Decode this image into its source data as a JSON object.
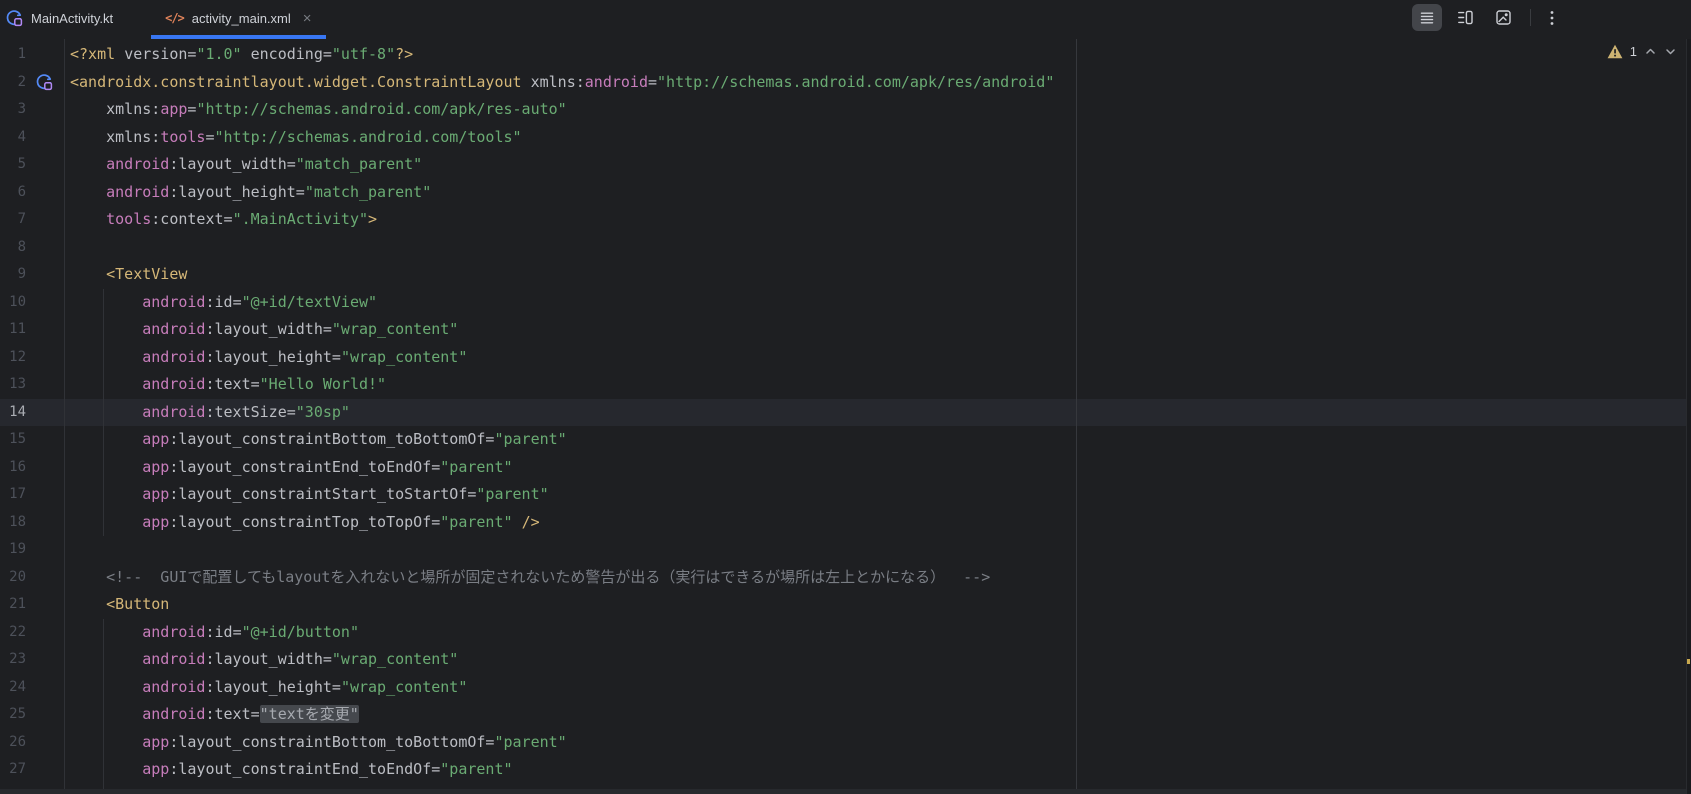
{
  "colors": {
    "editor_bg": "#1E1F22",
    "current_line_bg": "#26282E",
    "active_tab_underline": "#3876F2",
    "syntax_tag": "#D5B778",
    "syntax_namespace": "#C77DBB",
    "syntax_attr": "#BCBEC4",
    "syntax_value": "#6AAB73",
    "syntax_comment": "#7A7E85",
    "warn_highlight_bg": "#45484D",
    "warn_highlight_text": "#A7AAB0",
    "warning_icon": "#CDB372",
    "xml_tab_icon_color": "#E0835A",
    "related_icon_blue": "#548AF7",
    "related_icon_purple": "#B189F5"
  },
  "tabbar": {
    "tabs": [
      {
        "label": "MainActivity.kt",
        "icon": "related-activity-icon",
        "active": false
      },
      {
        "label": "activity_main.xml",
        "icon": "xml-code-icon",
        "icon_glyph": "</>",
        "close_glyph": "×",
        "active": true
      }
    ],
    "view_modes": [
      {
        "name": "code",
        "selected": true
      },
      {
        "name": "split",
        "selected": false
      },
      {
        "name": "design",
        "selected": false
      }
    ]
  },
  "inspection": {
    "warning_count": "1"
  },
  "editor": {
    "current_line": 14,
    "gutter_icon_line": 2,
    "lines": [
      {
        "n": 1,
        "t": [
          [
            "t",
            "<?xml"
          ],
          [
            "p",
            " "
          ],
          [
            "a",
            "version"
          ],
          [
            "p",
            "="
          ],
          [
            "v",
            "\"1.0\""
          ],
          [
            "p",
            " "
          ],
          [
            "a",
            "encoding"
          ],
          [
            "p",
            "="
          ],
          [
            "v",
            "\"utf-8\""
          ],
          [
            "t",
            "?>"
          ]
        ]
      },
      {
        "n": 2,
        "t": [
          [
            "t",
            "<androidx.constraintlayout.widget.ConstraintLayout"
          ],
          [
            "p",
            " "
          ],
          [
            "a",
            "xmlns:"
          ],
          [
            "n",
            "android"
          ],
          [
            "p",
            "="
          ],
          [
            "v",
            "\"http://schemas.android.com/apk/res/android\""
          ]
        ]
      },
      {
        "n": 3,
        "t": [
          [
            "p",
            "    "
          ],
          [
            "a",
            "xmlns:"
          ],
          [
            "n",
            "app"
          ],
          [
            "p",
            "="
          ],
          [
            "v",
            "\"http://schemas.android.com/apk/res-auto\""
          ]
        ]
      },
      {
        "n": 4,
        "t": [
          [
            "p",
            "    "
          ],
          [
            "a",
            "xmlns:"
          ],
          [
            "n",
            "tools"
          ],
          [
            "p",
            "="
          ],
          [
            "v",
            "\"http://schemas.android.com/tools\""
          ]
        ]
      },
      {
        "n": 5,
        "t": [
          [
            "p",
            "    "
          ],
          [
            "n",
            "android"
          ],
          [
            "a",
            ":layout_width"
          ],
          [
            "p",
            "="
          ],
          [
            "v",
            "\"match_parent\""
          ]
        ]
      },
      {
        "n": 6,
        "t": [
          [
            "p",
            "    "
          ],
          [
            "n",
            "android"
          ],
          [
            "a",
            ":layout_height"
          ],
          [
            "p",
            "="
          ],
          [
            "v",
            "\"match_parent\""
          ]
        ]
      },
      {
        "n": 7,
        "t": [
          [
            "p",
            "    "
          ],
          [
            "n",
            "tools"
          ],
          [
            "a",
            ":context"
          ],
          [
            "p",
            "="
          ],
          [
            "v",
            "\".MainActivity\""
          ],
          [
            "t",
            ">"
          ]
        ]
      },
      {
        "n": 8,
        "t": []
      },
      {
        "n": 9,
        "t": [
          [
            "p",
            "    "
          ],
          [
            "t",
            "<TextView"
          ]
        ]
      },
      {
        "n": 10,
        "t": [
          [
            "p",
            "        "
          ],
          [
            "n",
            "android"
          ],
          [
            "a",
            ":id"
          ],
          [
            "p",
            "="
          ],
          [
            "v",
            "\"@+id/textView\""
          ]
        ]
      },
      {
        "n": 11,
        "t": [
          [
            "p",
            "        "
          ],
          [
            "n",
            "android"
          ],
          [
            "a",
            ":layout_width"
          ],
          [
            "p",
            "="
          ],
          [
            "v",
            "\"wrap_content\""
          ]
        ]
      },
      {
        "n": 12,
        "t": [
          [
            "p",
            "        "
          ],
          [
            "n",
            "android"
          ],
          [
            "a",
            ":layout_height"
          ],
          [
            "p",
            "="
          ],
          [
            "v",
            "\"wrap_content\""
          ]
        ]
      },
      {
        "n": 13,
        "t": [
          [
            "p",
            "        "
          ],
          [
            "n",
            "android"
          ],
          [
            "a",
            ":text"
          ],
          [
            "p",
            "="
          ],
          [
            "v",
            "\"Hello World!\""
          ]
        ]
      },
      {
        "n": 14,
        "t": [
          [
            "p",
            "        "
          ],
          [
            "n",
            "android"
          ],
          [
            "a",
            ":textSize"
          ],
          [
            "p",
            "="
          ],
          [
            "v",
            "\"30sp\""
          ]
        ]
      },
      {
        "n": 15,
        "t": [
          [
            "p",
            "        "
          ],
          [
            "n",
            "app"
          ],
          [
            "a",
            ":layout_constraintBottom_toBottomOf"
          ],
          [
            "p",
            "="
          ],
          [
            "v",
            "\"parent\""
          ]
        ]
      },
      {
        "n": 16,
        "t": [
          [
            "p",
            "        "
          ],
          [
            "n",
            "app"
          ],
          [
            "a",
            ":layout_constraintEnd_toEndOf"
          ],
          [
            "p",
            "="
          ],
          [
            "v",
            "\"parent\""
          ]
        ]
      },
      {
        "n": 17,
        "t": [
          [
            "p",
            "        "
          ],
          [
            "n",
            "app"
          ],
          [
            "a",
            ":layout_constraintStart_toStartOf"
          ],
          [
            "p",
            "="
          ],
          [
            "v",
            "\"parent\""
          ]
        ]
      },
      {
        "n": 18,
        "t": [
          [
            "p",
            "        "
          ],
          [
            "n",
            "app"
          ],
          [
            "a",
            ":layout_constraintTop_toTopOf"
          ],
          [
            "p",
            "="
          ],
          [
            "v",
            "\"parent\""
          ],
          [
            "p",
            " "
          ],
          [
            "t",
            "/>"
          ]
        ]
      },
      {
        "n": 19,
        "t": []
      },
      {
        "n": 20,
        "t": [
          [
            "p",
            "    "
          ],
          [
            "c",
            "<!--  GUIで配置してもlayoutを入れないと場所が固定されないため警告が出る（実行はできるが場所は左上とかになる）  -->"
          ]
        ]
      },
      {
        "n": 21,
        "t": [
          [
            "p",
            "    "
          ],
          [
            "t",
            "<Button"
          ]
        ]
      },
      {
        "n": 22,
        "t": [
          [
            "p",
            "        "
          ],
          [
            "n",
            "android"
          ],
          [
            "a",
            ":id"
          ],
          [
            "p",
            "="
          ],
          [
            "v",
            "\"@+id/button\""
          ]
        ]
      },
      {
        "n": 23,
        "t": [
          [
            "p",
            "        "
          ],
          [
            "n",
            "android"
          ],
          [
            "a",
            ":layout_width"
          ],
          [
            "p",
            "="
          ],
          [
            "v",
            "\"wrap_content\""
          ]
        ]
      },
      {
        "n": 24,
        "t": [
          [
            "p",
            "        "
          ],
          [
            "n",
            "android"
          ],
          [
            "a",
            ":layout_height"
          ],
          [
            "p",
            "="
          ],
          [
            "v",
            "\"wrap_content\""
          ]
        ]
      },
      {
        "n": 25,
        "t": [
          [
            "p",
            "        "
          ],
          [
            "n",
            "android"
          ],
          [
            "a",
            ":text"
          ],
          [
            "p",
            "="
          ],
          [
            "w",
            "\"textを変更\""
          ]
        ]
      },
      {
        "n": 26,
        "t": [
          [
            "p",
            "        "
          ],
          [
            "n",
            "app"
          ],
          [
            "a",
            ":layout_constraintBottom_toBottomOf"
          ],
          [
            "p",
            "="
          ],
          [
            "v",
            "\"parent\""
          ]
        ]
      },
      {
        "n": 27,
        "t": [
          [
            "p",
            "        "
          ],
          [
            "n",
            "app"
          ],
          [
            "a",
            ":layout_constraintEnd_toEndOf"
          ],
          [
            "p",
            "="
          ],
          [
            "v",
            "\"parent\""
          ]
        ]
      }
    ]
  }
}
